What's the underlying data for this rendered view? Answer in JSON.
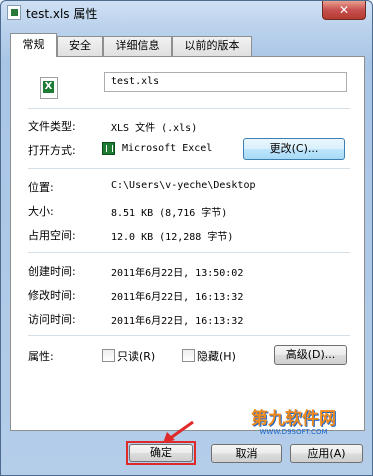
{
  "window": {
    "title": "test.xls 属性",
    "close_glyph": "✕"
  },
  "tabs": [
    {
      "label": "常规",
      "active": true
    },
    {
      "label": "安全",
      "active": false
    },
    {
      "label": "详细信息",
      "active": false
    },
    {
      "label": "以前的版本",
      "active": false
    }
  ],
  "general": {
    "file_name": "test.xls",
    "type_label": "文件类型:",
    "type_value": "XLS 文件 (.xls)",
    "open_with_label": "打开方式:",
    "open_with_value": "Microsoft Excel",
    "change_button": "更改(C)...",
    "location_label": "位置:",
    "location_value": "C:\\Users\\v-yeche\\Desktop",
    "size_label": "大小:",
    "size_value": "8.51 KB (8,716 字节)",
    "size_on_disk_label": "占用空间:",
    "size_on_disk_value": "12.0 KB (12,288 字节)",
    "created_label": "创建时间:",
    "created_value": "2011年6月22日, 13:50:02",
    "modified_label": "修改时间:",
    "modified_value": "2011年6月22日, 16:13:32",
    "accessed_label": "访问时间:",
    "accessed_value": "2011年6月22日, 16:13:32",
    "attributes_label": "属性:",
    "readonly_label": "只读(R)",
    "hidden_label": "隐藏(H)",
    "advanced_button": "高级(D)..."
  },
  "footer": {
    "ok_button": "确定",
    "cancel_button": "取消",
    "apply_button": "应用(A)"
  },
  "watermark": {
    "brand": "第九软件网",
    "url": "WWW.D9SOFT.COM"
  },
  "colors": {
    "highlight": "#e02a2a",
    "watermark_orange": "#f08a1c",
    "watermark_blue": "#1a66c8"
  }
}
